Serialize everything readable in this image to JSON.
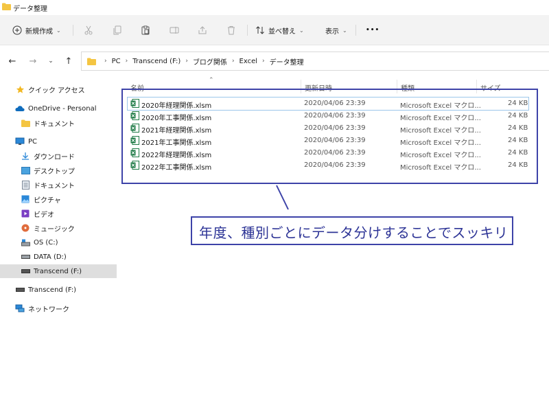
{
  "window": {
    "title": "データ整理"
  },
  "toolbar": {
    "new_label": "新規作成",
    "sort_label": "並べ替え",
    "view_label": "表示",
    "more_label": "•••"
  },
  "address": {
    "crumbs": [
      "PC",
      "Transcend (F:)",
      "ブログ関係",
      "Excel",
      "データ整理"
    ]
  },
  "sidebar": {
    "items": [
      {
        "label": "クイック アクセス"
      },
      {
        "label": "OneDrive - Personal"
      },
      {
        "label": "ドキュメント"
      },
      {
        "label": "PC"
      },
      {
        "label": "ダウンロード"
      },
      {
        "label": "デスクトップ"
      },
      {
        "label": "ドキュメント"
      },
      {
        "label": "ピクチャ"
      },
      {
        "label": "ビデオ"
      },
      {
        "label": "ミュージック"
      },
      {
        "label": "OS (C:)"
      },
      {
        "label": "DATA (D:)"
      },
      {
        "label": "Transcend (F:)"
      },
      {
        "label": "Transcend (F:)"
      },
      {
        "label": "ネットワーク"
      }
    ]
  },
  "columns": {
    "name": "名前",
    "date": "更新日時",
    "type": "種類",
    "size": "サイズ"
  },
  "files": [
    {
      "name": "2020年経理関係.xlsm",
      "date": "2020/04/06 23:39",
      "type": "Microsoft Excel マクロ...",
      "size": "24 KB"
    },
    {
      "name": "2020年工事関係.xlsm",
      "date": "2020/04/06 23:39",
      "type": "Microsoft Excel マクロ...",
      "size": "24 KB"
    },
    {
      "name": "2021年経理関係.xlsm",
      "date": "2020/04/06 23:39",
      "type": "Microsoft Excel マクロ...",
      "size": "24 KB"
    },
    {
      "name": "2021年工事関係.xlsm",
      "date": "2020/04/06 23:39",
      "type": "Microsoft Excel マクロ...",
      "size": "24 KB"
    },
    {
      "name": "2022年経理関係.xlsm",
      "date": "2020/04/06 23:39",
      "type": "Microsoft Excel マクロ...",
      "size": "24 KB"
    },
    {
      "name": "2022年工事関係.xlsm",
      "date": "2020/04/06 23:39",
      "type": "Microsoft Excel マクロ...",
      "size": "24 KB"
    }
  ],
  "annotation": {
    "text": "年度、種別ごとにデータ分けすることでスッキリ"
  },
  "colors": {
    "annotation": "#3d43a8",
    "excel": "#1d7a45",
    "folder": "#f4c542"
  }
}
